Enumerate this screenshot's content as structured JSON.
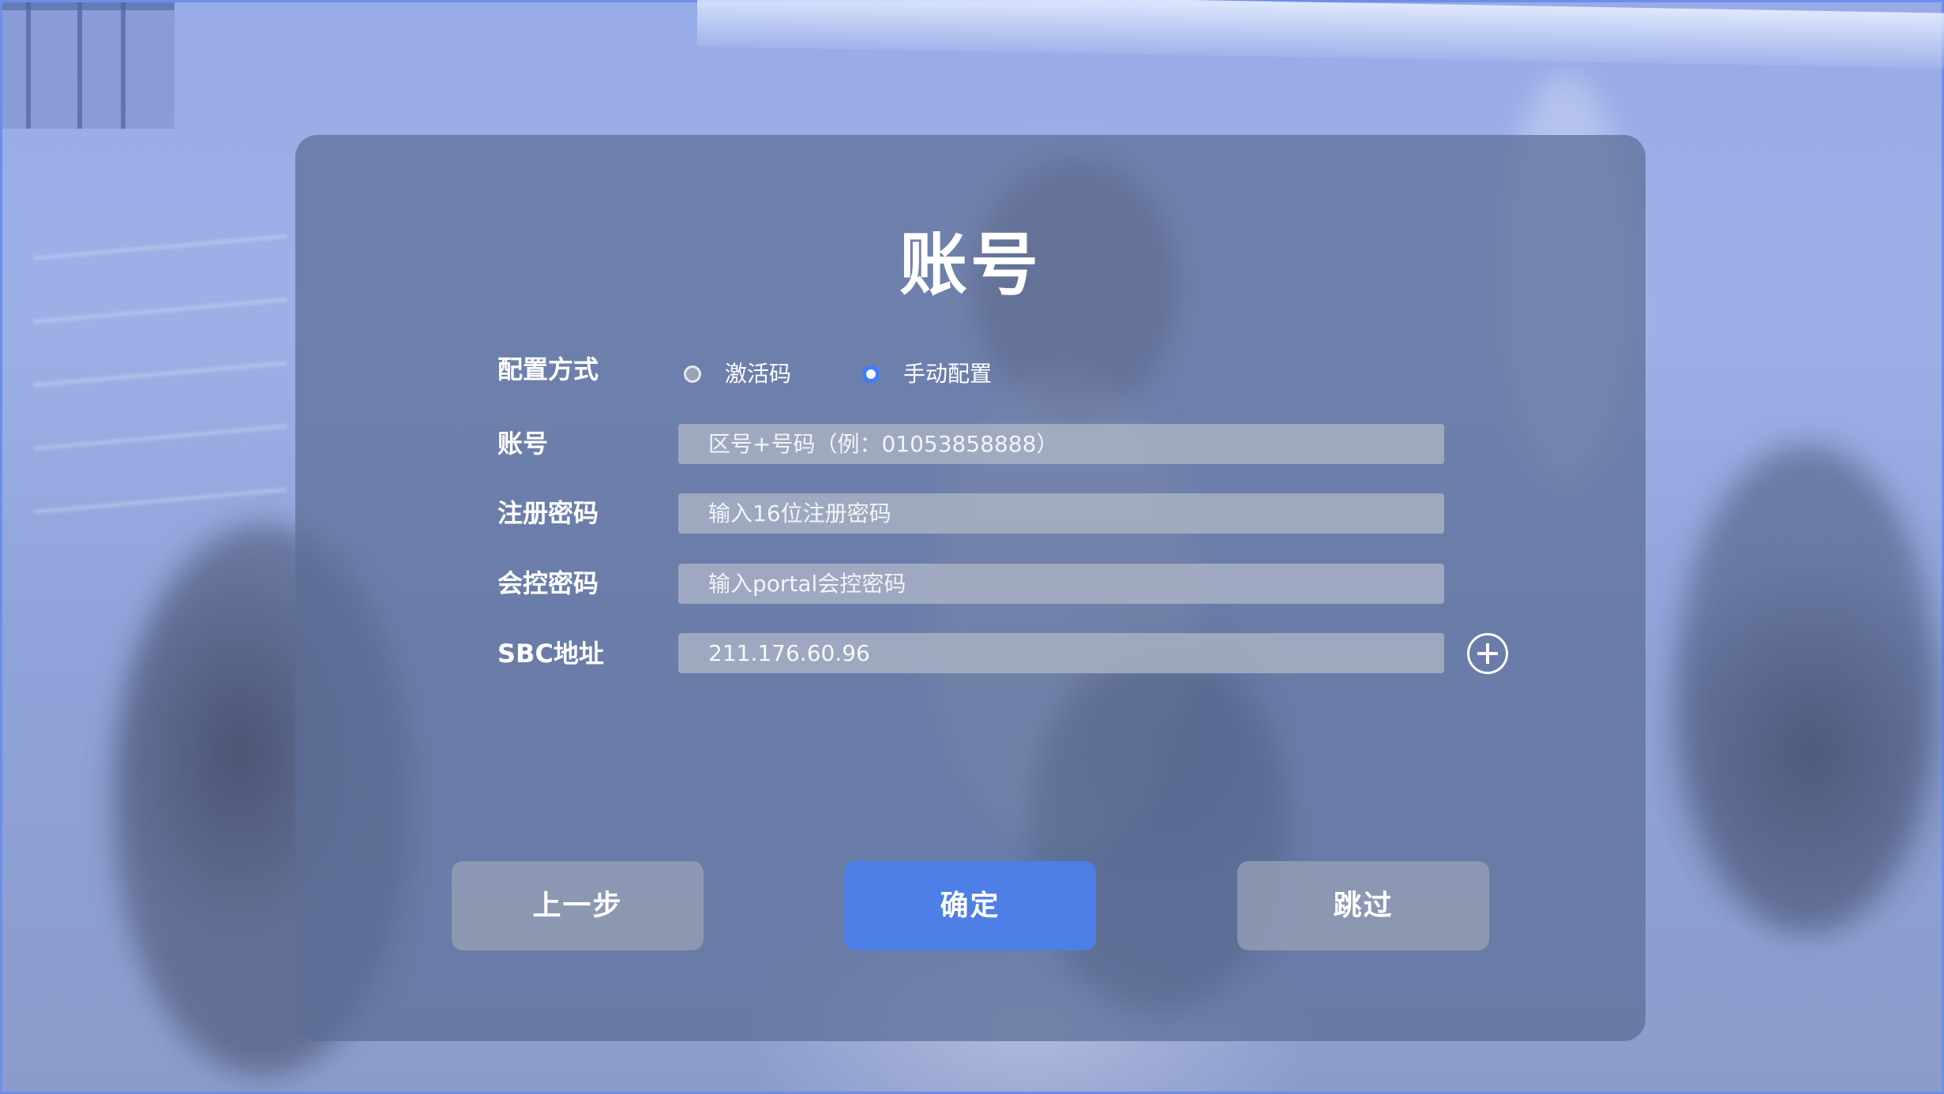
{
  "dialog": {
    "title": "账号",
    "config_method": {
      "label": "配置方式",
      "options": [
        {
          "label": "激活码",
          "selected": false
        },
        {
          "label": "手动配置",
          "selected": true
        }
      ]
    },
    "account": {
      "label": "账号",
      "value": "",
      "placeholder": "区号+号码（例：01053858888）"
    },
    "register_password": {
      "label": "注册密码",
      "value": "",
      "placeholder": "输入16位注册密码"
    },
    "control_password": {
      "label": "会控密码",
      "value": "",
      "placeholder": "输入portal会控密码"
    },
    "sbc_address": {
      "label": "SBC地址",
      "value": "211.176.60.96",
      "add_icon": "plus-circle-icon"
    },
    "buttons": {
      "prev": "上一步",
      "confirm": "确定",
      "skip": "跳过"
    }
  },
  "colors": {
    "primary": "#4d7fe6",
    "radio_selected": "#3f7cff",
    "dialog_bg": "#5c6e96",
    "frame_border": "#6d8ee8"
  }
}
